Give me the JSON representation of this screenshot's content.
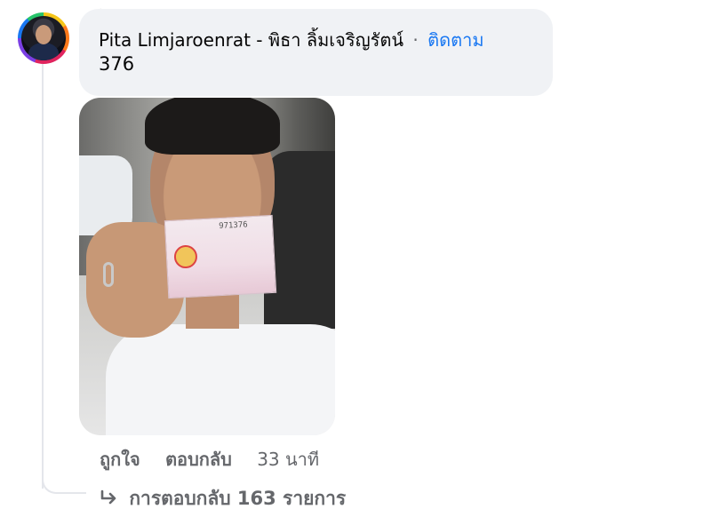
{
  "top_fragment": "ุ",
  "comment": {
    "author": "Pita Limjaroenrat - พิธา ลิ้มเจริญรัตน์",
    "separator": "·",
    "follow_label": "ติดตาม",
    "text": "376"
  },
  "photo": {
    "ticket_number": "971376"
  },
  "actions": {
    "like_label": "ถูกใจ",
    "reply_label": "ตอบกลับ",
    "timestamp": "33 นาที"
  },
  "replies": {
    "label": "การตอบกลับ 163 รายการ",
    "icon": "reply-arrow-icon"
  },
  "colors": {
    "link": "#1877f2",
    "muted": "#65676b",
    "bubble": "#f0f2f5"
  }
}
